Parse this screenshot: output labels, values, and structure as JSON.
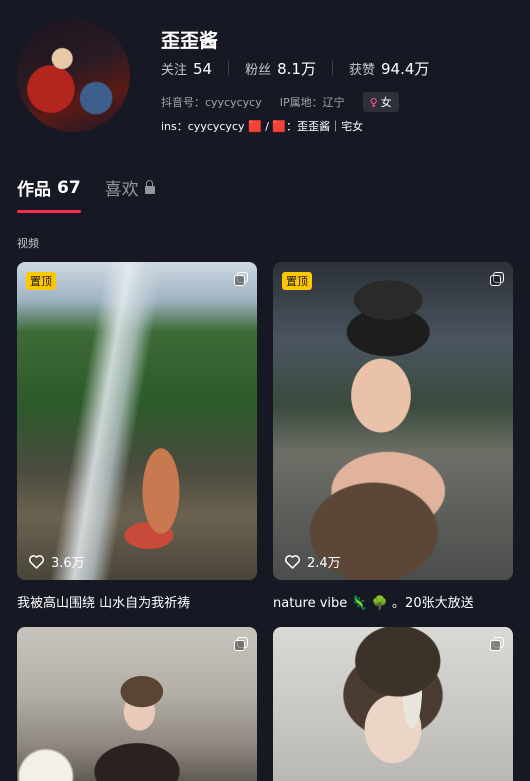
{
  "profile": {
    "username": "歪歪酱",
    "stats": [
      {
        "label": "关注",
        "value": "54"
      },
      {
        "label": "粉丝",
        "value": "8.1万"
      },
      {
        "label": "获赞",
        "value": "94.4万"
      }
    ],
    "douyin_id": "抖音号：cyycycycy",
    "ip_location": "IP属地：辽宁",
    "gender_symbol": "♀",
    "gender": "女",
    "bio": "ins：cyycycycy 🟥 / 🟥：歪歪酱｜宅女"
  },
  "tabs": [
    {
      "label": "作品",
      "count": "67"
    },
    {
      "label": "喜欢"
    }
  ],
  "section_label": "视频",
  "videos": [
    {
      "pinned_label": "置顶",
      "likes": "3.6万",
      "caption": "我被高山围绕 山水自为我祈祷"
    },
    {
      "pinned_label": "置顶",
      "likes": "2.4万",
      "caption": "nature vibe 🦎 🌳 。20张大放送"
    },
    {},
    {}
  ],
  "colors": {
    "background": "#161823",
    "accent": "#fe2c55",
    "pin_badge": "#fec701"
  }
}
